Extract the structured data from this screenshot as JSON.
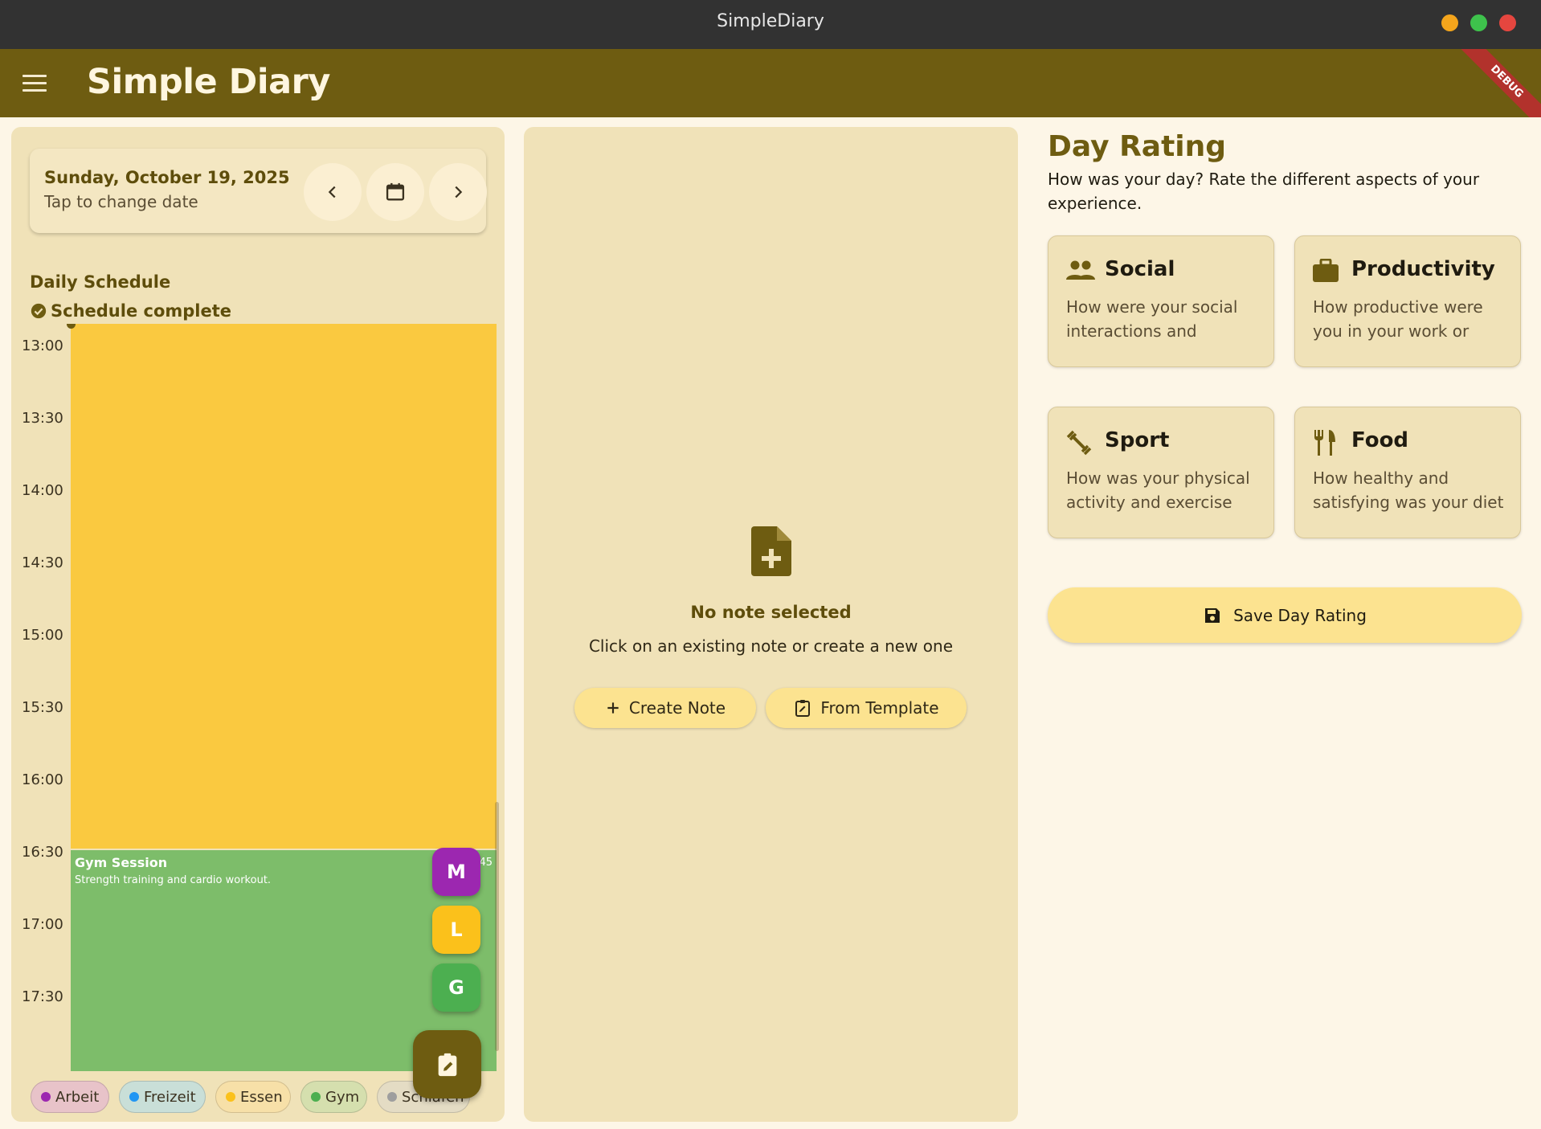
{
  "window": {
    "title": "SimpleDiary"
  },
  "appbar": {
    "title": "Simple Diary",
    "debug_banner": "DEBUG"
  },
  "date_selector": {
    "date": "Sunday, October 19, 2025",
    "hint": "Tap to change date"
  },
  "schedule": {
    "title": "Daily Schedule",
    "status": "Schedule complete",
    "time_labels": [
      "13:00",
      "13:30",
      "14:00",
      "14:30",
      "15:00",
      "15:30",
      "16:00",
      "16:30",
      "17:00",
      "17:30"
    ],
    "events": [
      {
        "title": "",
        "color": "#fac940"
      },
      {
        "title": "Gym Session",
        "description": "Strength training and cardio workout.",
        "time": "1 45",
        "color": "#7dbd6a"
      }
    ],
    "quick_buttons": [
      {
        "label": "M",
        "color": "#9c27b0"
      },
      {
        "label": "L",
        "color": "#fbc11b"
      },
      {
        "label": "G",
        "color": "#4caf50"
      }
    ],
    "categories": [
      {
        "label": "Arbeit",
        "color": "#9c27b0",
        "bg": "#e8c3c9"
      },
      {
        "label": "Freizeit",
        "color": "#2196f3",
        "bg": "#c9dfd8"
      },
      {
        "label": "Essen",
        "color": "#fbc11b",
        "bg": "#f7e0a8"
      },
      {
        "label": "Gym",
        "color": "#4caf50",
        "bg": "#d5dfae"
      },
      {
        "label": "Schlafen",
        "color": "#9e9e9e",
        "bg": "#e4dcc4"
      }
    ]
  },
  "notes": {
    "empty_title": "No note selected",
    "empty_subtitle": "Click on an existing note or create a new one",
    "create_label": "Create Note",
    "template_label": "From Template"
  },
  "day_rating": {
    "title": "Day Rating",
    "subtitle": "How was your day? Rate the different aspects of your experience.",
    "cards": [
      {
        "icon": "people-icon",
        "title": "Social",
        "description": "How were your social interactions and"
      },
      {
        "icon": "briefcase-icon",
        "title": "Productivity",
        "description": "How productive were you in your work or daily"
      },
      {
        "icon": "fitness-icon",
        "title": "Sport",
        "description": "How was your physical activity and exercise"
      },
      {
        "icon": "restaurant-icon",
        "title": "Food",
        "description": "How healthy and satisfying was your diet"
      }
    ],
    "save_label": "Save Day Rating"
  },
  "colors": {
    "primary": "#6e5c11",
    "surface": "#f0e2b8",
    "button": "#fce390"
  }
}
